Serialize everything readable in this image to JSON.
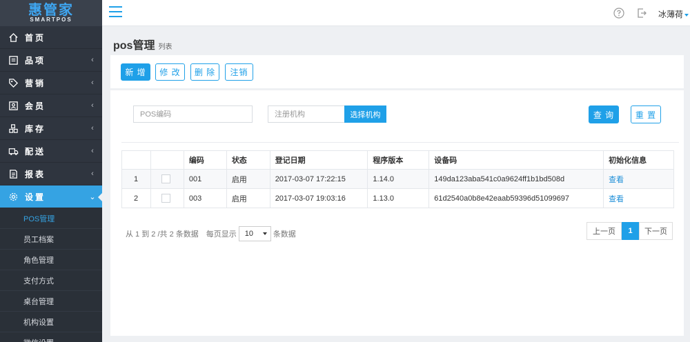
{
  "logo": {
    "main": "惠管家",
    "sub": "SMARTPOS"
  },
  "sidebar": {
    "items": [
      {
        "label": "首页",
        "icon": "home-icon"
      },
      {
        "label": "品项",
        "icon": "list-icon"
      },
      {
        "label": "营销",
        "icon": "tag-icon"
      },
      {
        "label": "会员",
        "icon": "member-card-icon"
      },
      {
        "label": "库存",
        "icon": "inventory-icon"
      },
      {
        "label": "配送",
        "icon": "truck-icon"
      },
      {
        "label": "报表",
        "icon": "report-icon"
      },
      {
        "label": "设置",
        "icon": "gear-icon"
      }
    ],
    "sub_items": [
      "POS管理",
      "员工档案",
      "角色管理",
      "支付方式",
      "桌台管理",
      "机构设置",
      "微信设置"
    ]
  },
  "header": {
    "user": "冰薄荷"
  },
  "page": {
    "title": "pos管理",
    "subtitle": "列表"
  },
  "toolbar": {
    "add": "新 增",
    "edit": "修 改",
    "delete": "删 除",
    "cancel": "注销"
  },
  "filters": {
    "pos_code_placeholder": "POS编码",
    "org_placeholder": "注册机构",
    "select_org": "选择机构",
    "query": "查 询",
    "reset": "重 置"
  },
  "table": {
    "headers": [
      "",
      "",
      "编码",
      "状态",
      "登记日期",
      "程序版本",
      "设备码",
      "初始化信息"
    ],
    "rows": [
      {
        "index": "1",
        "code": "001",
        "status": "启用",
        "date": "2017-03-07 17:22:15",
        "version": "1.14.0",
        "device": "149da123aba541c0a9624ff1b1bd508d",
        "action": "查看"
      },
      {
        "index": "2",
        "code": "003",
        "status": "启用",
        "date": "2017-03-07 19:03:16",
        "version": "1.13.0",
        "device": "61d2540a0b8e42eaab59396d51099697",
        "action": "查看"
      }
    ]
  },
  "pagination": {
    "info": "从 1 到 2 /共 2 条数据",
    "per_page_label": "每页显示",
    "per_page": "10",
    "per_page_suffix": "条数据",
    "prev": "上一页",
    "current": "1",
    "next": "下一页"
  },
  "colors": {
    "accent": "#1fa0e8",
    "sidebar_bg": "#2f353f",
    "sidebar_active": "#35a3e3"
  }
}
